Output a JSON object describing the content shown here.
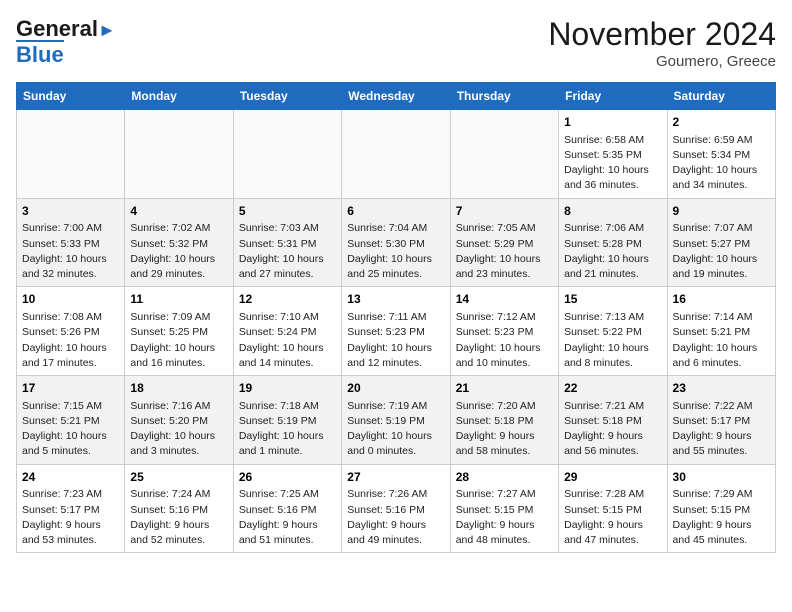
{
  "header": {
    "logo_line1": "General",
    "logo_line2": "Blue",
    "month": "November 2024",
    "location": "Goumero, Greece"
  },
  "weekdays": [
    "Sunday",
    "Monday",
    "Tuesday",
    "Wednesday",
    "Thursday",
    "Friday",
    "Saturday"
  ],
  "weeks": [
    [
      {
        "day": "",
        "info": ""
      },
      {
        "day": "",
        "info": ""
      },
      {
        "day": "",
        "info": ""
      },
      {
        "day": "",
        "info": ""
      },
      {
        "day": "",
        "info": ""
      },
      {
        "day": "1",
        "info": "Sunrise: 6:58 AM\nSunset: 5:35 PM\nDaylight: 10 hours and 36 minutes."
      },
      {
        "day": "2",
        "info": "Sunrise: 6:59 AM\nSunset: 5:34 PM\nDaylight: 10 hours and 34 minutes."
      }
    ],
    [
      {
        "day": "3",
        "info": "Sunrise: 7:00 AM\nSunset: 5:33 PM\nDaylight: 10 hours and 32 minutes."
      },
      {
        "day": "4",
        "info": "Sunrise: 7:02 AM\nSunset: 5:32 PM\nDaylight: 10 hours and 29 minutes."
      },
      {
        "day": "5",
        "info": "Sunrise: 7:03 AM\nSunset: 5:31 PM\nDaylight: 10 hours and 27 minutes."
      },
      {
        "day": "6",
        "info": "Sunrise: 7:04 AM\nSunset: 5:30 PM\nDaylight: 10 hours and 25 minutes."
      },
      {
        "day": "7",
        "info": "Sunrise: 7:05 AM\nSunset: 5:29 PM\nDaylight: 10 hours and 23 minutes."
      },
      {
        "day": "8",
        "info": "Sunrise: 7:06 AM\nSunset: 5:28 PM\nDaylight: 10 hours and 21 minutes."
      },
      {
        "day": "9",
        "info": "Sunrise: 7:07 AM\nSunset: 5:27 PM\nDaylight: 10 hours and 19 minutes."
      }
    ],
    [
      {
        "day": "10",
        "info": "Sunrise: 7:08 AM\nSunset: 5:26 PM\nDaylight: 10 hours and 17 minutes."
      },
      {
        "day": "11",
        "info": "Sunrise: 7:09 AM\nSunset: 5:25 PM\nDaylight: 10 hours and 16 minutes."
      },
      {
        "day": "12",
        "info": "Sunrise: 7:10 AM\nSunset: 5:24 PM\nDaylight: 10 hours and 14 minutes."
      },
      {
        "day": "13",
        "info": "Sunrise: 7:11 AM\nSunset: 5:23 PM\nDaylight: 10 hours and 12 minutes."
      },
      {
        "day": "14",
        "info": "Sunrise: 7:12 AM\nSunset: 5:23 PM\nDaylight: 10 hours and 10 minutes."
      },
      {
        "day": "15",
        "info": "Sunrise: 7:13 AM\nSunset: 5:22 PM\nDaylight: 10 hours and 8 minutes."
      },
      {
        "day": "16",
        "info": "Sunrise: 7:14 AM\nSunset: 5:21 PM\nDaylight: 10 hours and 6 minutes."
      }
    ],
    [
      {
        "day": "17",
        "info": "Sunrise: 7:15 AM\nSunset: 5:21 PM\nDaylight: 10 hours and 5 minutes."
      },
      {
        "day": "18",
        "info": "Sunrise: 7:16 AM\nSunset: 5:20 PM\nDaylight: 10 hours and 3 minutes."
      },
      {
        "day": "19",
        "info": "Sunrise: 7:18 AM\nSunset: 5:19 PM\nDaylight: 10 hours and 1 minute."
      },
      {
        "day": "20",
        "info": "Sunrise: 7:19 AM\nSunset: 5:19 PM\nDaylight: 10 hours and 0 minutes."
      },
      {
        "day": "21",
        "info": "Sunrise: 7:20 AM\nSunset: 5:18 PM\nDaylight: 9 hours and 58 minutes."
      },
      {
        "day": "22",
        "info": "Sunrise: 7:21 AM\nSunset: 5:18 PM\nDaylight: 9 hours and 56 minutes."
      },
      {
        "day": "23",
        "info": "Sunrise: 7:22 AM\nSunset: 5:17 PM\nDaylight: 9 hours and 55 minutes."
      }
    ],
    [
      {
        "day": "24",
        "info": "Sunrise: 7:23 AM\nSunset: 5:17 PM\nDaylight: 9 hours and 53 minutes."
      },
      {
        "day": "25",
        "info": "Sunrise: 7:24 AM\nSunset: 5:16 PM\nDaylight: 9 hours and 52 minutes."
      },
      {
        "day": "26",
        "info": "Sunrise: 7:25 AM\nSunset: 5:16 PM\nDaylight: 9 hours and 51 minutes."
      },
      {
        "day": "27",
        "info": "Sunrise: 7:26 AM\nSunset: 5:16 PM\nDaylight: 9 hours and 49 minutes."
      },
      {
        "day": "28",
        "info": "Sunrise: 7:27 AM\nSunset: 5:15 PM\nDaylight: 9 hours and 48 minutes."
      },
      {
        "day": "29",
        "info": "Sunrise: 7:28 AM\nSunset: 5:15 PM\nDaylight: 9 hours and 47 minutes."
      },
      {
        "day": "30",
        "info": "Sunrise: 7:29 AM\nSunset: 5:15 PM\nDaylight: 9 hours and 45 minutes."
      }
    ]
  ]
}
